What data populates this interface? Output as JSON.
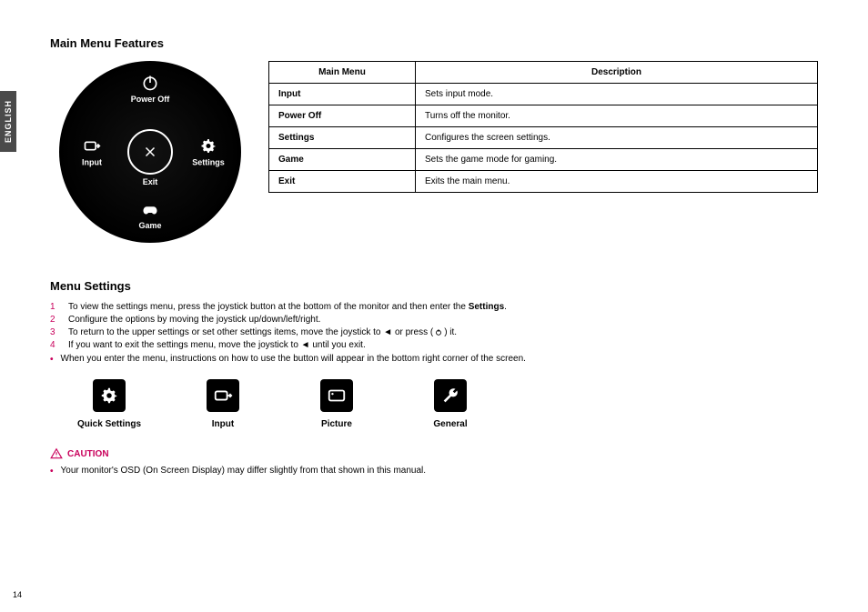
{
  "sideTab": "ENGLISH",
  "section1": {
    "title": "Main Menu Features",
    "circle": {
      "top": {
        "label": "Power Off"
      },
      "left": {
        "label": "Input"
      },
      "right": {
        "label": "Settings"
      },
      "bottom": {
        "label": "Game"
      },
      "center": {
        "label": "Exit"
      }
    },
    "table": {
      "headers": [
        "Main Menu",
        "Description"
      ],
      "rows": [
        {
          "name": "Input",
          "desc": "Sets input mode."
        },
        {
          "name": "Power Off",
          "desc": "Turns off the monitor."
        },
        {
          "name": "Settings",
          "desc": "Configures the screen settings."
        },
        {
          "name": "Game",
          "desc": "Sets the game mode for gaming."
        },
        {
          "name": "Exit",
          "desc": "Exits the main menu."
        }
      ]
    }
  },
  "section2": {
    "title": "Menu Settings",
    "steps": [
      {
        "n": "1",
        "pre": "To view the settings menu, press the joystick button at the bottom of the monitor and then enter the ",
        "bold": "Settings",
        "post": "."
      },
      {
        "n": "2",
        "pre": "Configure the options by moving the joystick up/down/left/right.",
        "bold": "",
        "post": ""
      },
      {
        "n": "3",
        "pre": "To return to the upper settings or set other settings items, move the joystick to ◄ or press (",
        "bold": "",
        "post": ") it.",
        "pressIcon": true
      },
      {
        "n": "4",
        "pre": "If you want to exit the settings menu, move the joystick to ◄ until you exit.",
        "bold": "",
        "post": ""
      }
    ],
    "note": "When you enter the menu, instructions on how to use the button will appear in the bottom right corner of the screen.",
    "icons": [
      {
        "label": "Quick Settings"
      },
      {
        "label": "Input"
      },
      {
        "label": "Picture"
      },
      {
        "label": "General"
      }
    ],
    "cautionLabel": "CAUTION",
    "cautionText": "Your monitor's OSD (On Screen Display) may differ slightly from that shown in this manual."
  },
  "pageNumber": "14"
}
